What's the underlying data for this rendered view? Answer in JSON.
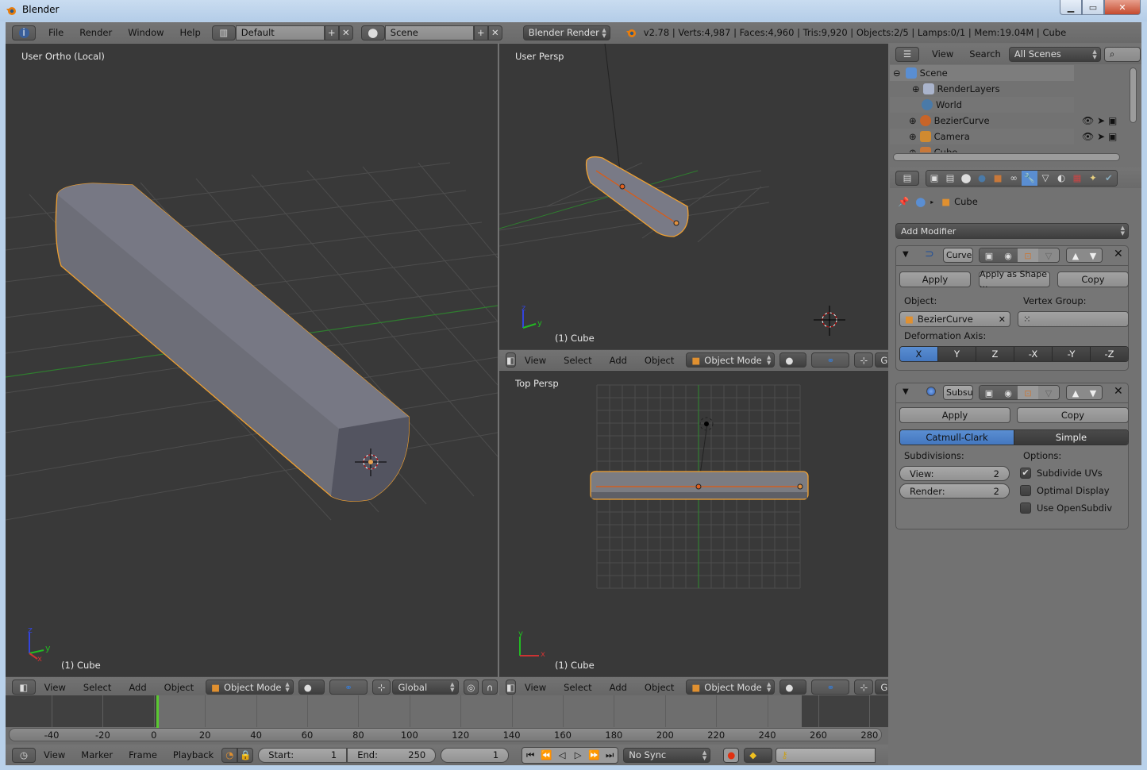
{
  "window": {
    "title": "Blender",
    "controls": {
      "minimize": "minimize",
      "maximize": "maximize",
      "close": "close"
    }
  },
  "topbar": {
    "menus": [
      "File",
      "Render",
      "Window",
      "Help"
    ],
    "layout": "Default",
    "scene": "Scene",
    "engine": "Blender Render",
    "stats": "v2.78 | Verts:4,987 | Faces:4,960 | Tris:9,920 | Objects:2/5 | Lamps:0/1 | Mem:19.04M | Cube"
  },
  "viewports": {
    "left": {
      "label": "User Ortho (Local)",
      "object": "(1) Cube"
    },
    "top_right": {
      "label": "User Persp",
      "object": "(1) Cube"
    },
    "bottom_right": {
      "label": "Top Persp",
      "object": "(1) Cube"
    }
  },
  "view_header": {
    "menus": [
      "View",
      "Select",
      "Add",
      "Object"
    ],
    "mode": "Object Mode",
    "orientation": "Global",
    "orientation_clipped": "Gl"
  },
  "outliner": {
    "menus": [
      "View",
      "Search"
    ],
    "filter": "All Scenes",
    "items": [
      {
        "name": "Scene",
        "level": 0
      },
      {
        "name": "RenderLayers",
        "level": 1
      },
      {
        "name": "World",
        "level": 1
      },
      {
        "name": "BezierCurve",
        "level": 1
      },
      {
        "name": "Camera",
        "level": 1
      },
      {
        "name": "Cube",
        "level": 1
      }
    ]
  },
  "properties": {
    "breadcrumb": "Cube",
    "add_modifier": "Add Modifier",
    "modifiers": [
      {
        "name": "Curve",
        "apply": "Apply",
        "apply_shape": "Apply as Shape ...",
        "copy": "Copy",
        "object_label": "Object:",
        "object_value": "BezierCurve",
        "vertex_group_label": "Vertex Group:",
        "axis_label": "Deformation Axis:",
        "axes": [
          "X",
          "Y",
          "Z",
          "-X",
          "-Y",
          "-Z"
        ],
        "active_axis": "X"
      },
      {
        "name": "Subsu",
        "apply": "Apply",
        "copy": "Copy",
        "types": [
          "Catmull-Clark",
          "Simple"
        ],
        "active_type": "Catmull-Clark",
        "subdivisions_label": "Subdivisions:",
        "view_label": "View:",
        "view_value": "2",
        "render_label": "Render:",
        "render_value": "2",
        "options_label": "Options:",
        "options": [
          {
            "label": "Subdivide UVs",
            "checked": true
          },
          {
            "label": "Optimal Display",
            "checked": false
          },
          {
            "label": "Use OpenSubdiv",
            "checked": false
          }
        ]
      }
    ]
  },
  "timeline": {
    "ticks": [
      "-40",
      "-20",
      "0",
      "20",
      "40",
      "60",
      "80",
      "100",
      "120",
      "140",
      "160",
      "180",
      "200",
      "220",
      "240",
      "260",
      "280"
    ],
    "menus": [
      "View",
      "Marker",
      "Frame",
      "Playback"
    ],
    "start_label": "Start:",
    "start": "1",
    "end_label": "End:",
    "end": "250",
    "current": "1",
    "sync": "No Sync"
  }
}
